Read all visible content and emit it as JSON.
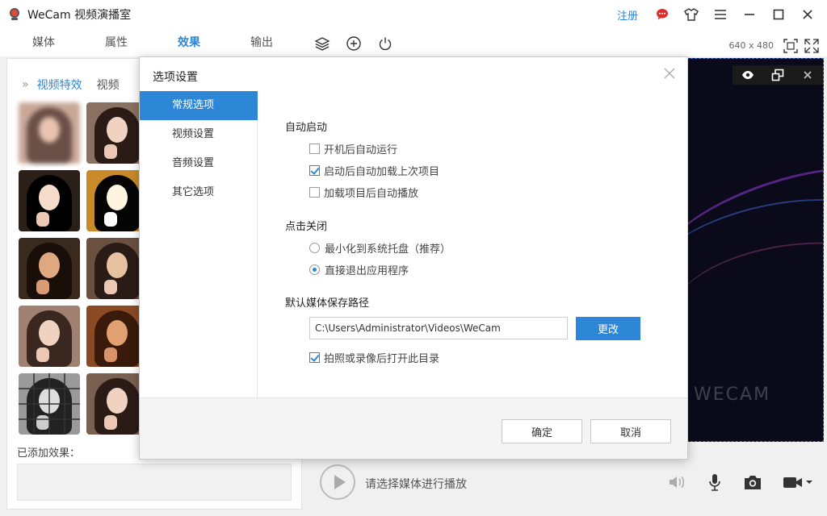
{
  "app": {
    "title": "WeCam 视频演播室",
    "register": "注册"
  },
  "main_tabs": [
    {
      "label": "媒体"
    },
    {
      "label": "属性"
    },
    {
      "label": "效果"
    },
    {
      "label": "输出"
    }
  ],
  "preview": {
    "resolution": "640 x 480",
    "watermark": "WECAM"
  },
  "left_panel": {
    "subtabs": [
      {
        "label": "视频特效"
      },
      {
        "label": "视频"
      }
    ],
    "added_label": "已添加效果："
  },
  "playback": {
    "hint": "请选择媒体进行播放"
  },
  "dialog": {
    "title": "选项设置",
    "nav": [
      {
        "label": "常规选项"
      },
      {
        "label": "视频设置"
      },
      {
        "label": "音频设置"
      },
      {
        "label": "其它选项"
      }
    ],
    "autostart": {
      "title": "自动启动",
      "options": [
        {
          "label": "开机后自动运行",
          "checked": false
        },
        {
          "label": "启动后自动加载上次项目",
          "checked": true
        },
        {
          "label": "加载项目后自动播放",
          "checked": false
        }
      ]
    },
    "close_action": {
      "title": "点击关闭",
      "options": [
        {
          "label": "最小化到系统托盘（推荐）",
          "selected": false
        },
        {
          "label": "直接退出应用程序",
          "selected": true
        }
      ]
    },
    "save_path": {
      "title": "默认媒体保存路径",
      "value": "C:\\Users\\Administrator\\Videos\\WeCam",
      "change": "更改",
      "open_after": {
        "label": "拍照或录像后打开此目录",
        "checked": true
      }
    },
    "ok": "确定",
    "cancel": "取消"
  },
  "colors": {
    "accent": "#2e86d6",
    "preview_bg": "#0b0a1a"
  }
}
